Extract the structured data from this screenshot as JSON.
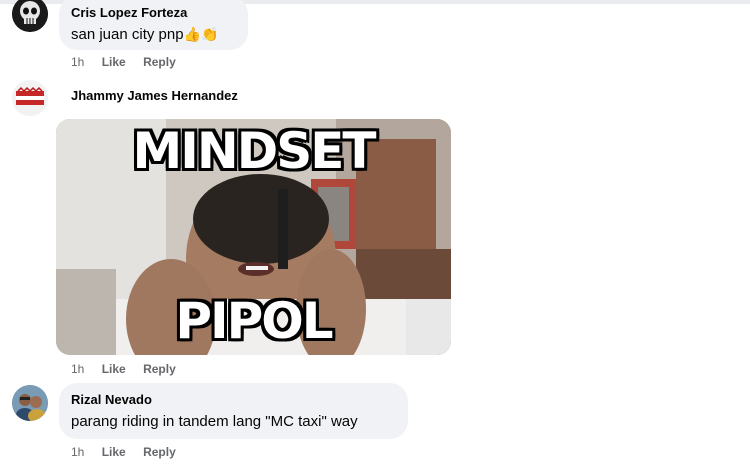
{
  "comments": [
    {
      "name": "Cris Lopez Forteza",
      "text": "san juan city pnp",
      "emoji": "👍👏",
      "time": "1h",
      "like": "Like",
      "reply": "Reply",
      "avatar_icon": "skull-avatar"
    },
    {
      "name": "Jhammy James Hernandez",
      "time": "1h",
      "like": "Like",
      "reply": "Reply",
      "avatar_icon": "flag-avatar",
      "meme": {
        "top_text": "MINDSET",
        "bottom_text": "PIPOL"
      }
    },
    {
      "name": "Rizal Nevado",
      "text": "parang riding in tandem lang \"MC taxi\" way",
      "time": "1h",
      "like": "Like",
      "reply": "Reply",
      "avatar_icon": "photo-avatar"
    }
  ],
  "colors": {
    "bubble": "#f0f2f5",
    "meta": "#65676b",
    "text": "#050505"
  }
}
